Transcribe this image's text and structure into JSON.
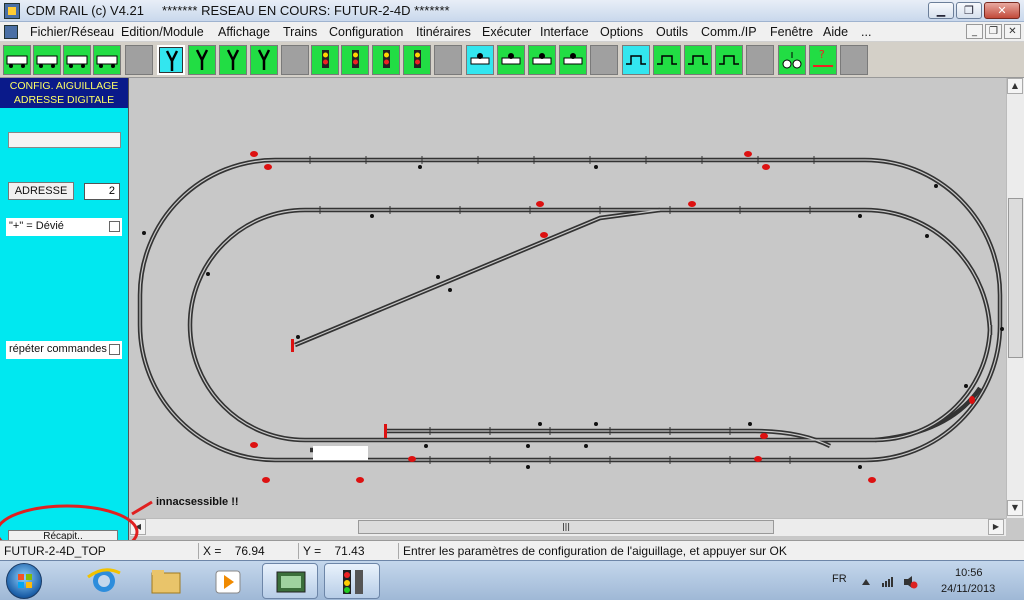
{
  "window": {
    "title": "CDM RAIL (c) V4.21     ******* RESEAU EN COURS: FUTUR-2-4D *******",
    "minimize": "0",
    "maximize": "1",
    "close": "r"
  },
  "menu": {
    "items": [
      "Fichier/Réseau",
      "Edition/Module",
      "Affichage",
      "Trains",
      "Configuration",
      "Itinéraires",
      "Exécuter",
      "Interface",
      "Options",
      "Outils",
      "Comm./IP",
      "Fenêtre",
      "Aide",
      "..."
    ]
  },
  "toolbar": {
    "buttons": [
      {
        "name": "train-icon",
        "color": "green"
      },
      {
        "name": "train-couple-icon",
        "color": "green"
      },
      {
        "name": "train-up-down-icon",
        "color": "green"
      },
      {
        "name": "train-turn-icon",
        "color": "green"
      },
      {
        "name": "blank",
        "color": "gray"
      },
      {
        "name": "turnout-selected-icon",
        "color": "cyan"
      },
      {
        "name": "turnout-icon",
        "color": "green"
      },
      {
        "name": "turnout-arrow-icon",
        "color": "green"
      },
      {
        "name": "turnout-double-arrow-icon",
        "color": "green"
      },
      {
        "name": "blank",
        "color": "gray"
      },
      {
        "name": "signal-icon",
        "color": "green"
      },
      {
        "name": "signal-red-icon",
        "color": "green"
      },
      {
        "name": "signal-arrow-icon",
        "color": "green"
      },
      {
        "name": "signal-double-icon",
        "color": "green"
      },
      {
        "name": "blank",
        "color": "gray"
      },
      {
        "name": "detector-icon",
        "color": "cyan"
      },
      {
        "name": "detector-train-icon",
        "color": "green"
      },
      {
        "name": "detector-arrow-icon",
        "color": "green"
      },
      {
        "name": "detector-double-icon",
        "color": "green"
      },
      {
        "name": "blank",
        "color": "gray"
      },
      {
        "name": "block-icon",
        "color": "cyan"
      },
      {
        "name": "block-train-icon",
        "color": "green"
      },
      {
        "name": "block-arrow-icon",
        "color": "green"
      },
      {
        "name": "block-double-icon",
        "color": "green"
      },
      {
        "name": "blank",
        "color": "gray"
      },
      {
        "name": "route-icon",
        "color": "green"
      },
      {
        "name": "help-arrow-icon",
        "color": "green"
      },
      {
        "name": "blank",
        "color": "gray"
      }
    ]
  },
  "leftpanel": {
    "header_line1": "CONFIG. AIGUILLAGE",
    "header_line2": "ADRESSE DIGITALE",
    "adresse_label": "ADRESSE",
    "adresse_value": "2",
    "devie_label": "\"+\" = Dévié",
    "repeter_label": "répéter commandes",
    "bottom_button": "Récapit.."
  },
  "annotation": {
    "text": "innacsessible !!",
    "color": "#e02020"
  },
  "status": {
    "module": "FUTUR-2-4D_TOP",
    "x_label": "X =",
    "x_value": "76.94",
    "y_label": "Y =",
    "y_value": "71.43",
    "message": "Entrer les paramètres de configuration de l'aiguillage, et appuyer sur OK"
  },
  "taskbar": {
    "lang": "FR",
    "time": "10:56",
    "date": "24/11/2013"
  },
  "colors": {
    "canvas_bg": "#c8c8c8",
    "panel_bg": "#00e8f0",
    "header_bg": "#0a1a8a",
    "header_text": "#ffff66",
    "track": "#333333",
    "signal_red": "#dd1111"
  }
}
